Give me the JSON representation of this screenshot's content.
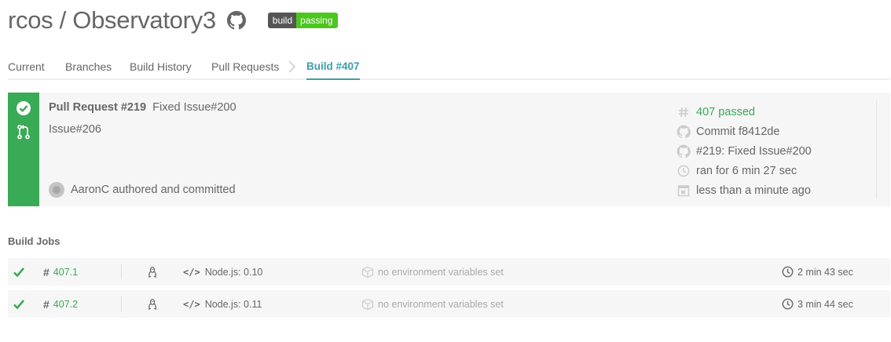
{
  "repo": {
    "title": "rcos / Observatory3",
    "badge": {
      "left": "build",
      "right": "passing"
    }
  },
  "tabs": [
    {
      "label": "Current"
    },
    {
      "label": "Branches"
    },
    {
      "label": "Build History"
    },
    {
      "label": "Pull Requests"
    },
    {
      "label": "Build #407"
    }
  ],
  "build": {
    "pr_label": "Pull Request #219",
    "pr_title": "Fixed Issue#200",
    "subtitle": "Issue#206",
    "author_text": "AaronC authored and committed",
    "meta": {
      "number": "407 passed",
      "commit": "Commit f8412de",
      "compare": "#219: Fixed Issue#200",
      "duration": "ran for 6 min 27 sec",
      "finished": "less than a minute ago"
    }
  },
  "jobs": {
    "title": "Build Jobs",
    "rows": [
      {
        "number": "407.1",
        "language": "Node.js: 0.10",
        "env": "no environment variables set",
        "duration": "2 min 43 sec"
      },
      {
        "number": "407.2",
        "language": "Node.js: 0.11",
        "env": "no environment variables set",
        "duration": "3 min 44 sec"
      }
    ]
  },
  "colors": {
    "success": "#39aa56",
    "accent": "#3f9ea6",
    "badge_passing": "#4cc61e"
  },
  "icons": [
    "github-icon",
    "check-circle-icon",
    "pull-request-icon",
    "hash-icon",
    "commit-icon",
    "clock-icon",
    "calendar-icon",
    "linux-icon",
    "code-icon",
    "box-icon",
    "checkmark-icon"
  ]
}
